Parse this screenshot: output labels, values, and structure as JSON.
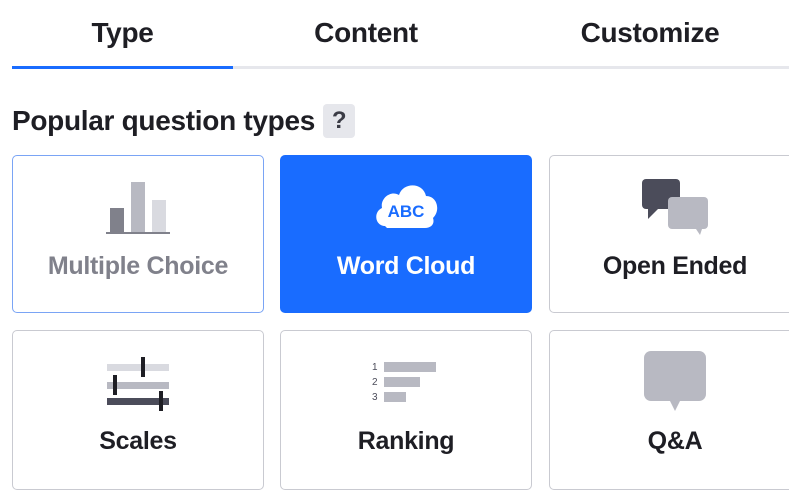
{
  "tabs": [
    {
      "label": "Type",
      "active": true
    },
    {
      "label": "Content",
      "active": false
    },
    {
      "label": "Customize",
      "active": false
    }
  ],
  "section": {
    "title": "Popular question types",
    "help": "?"
  },
  "cards": [
    {
      "label": "Multiple Choice",
      "icon": "bar-chart-icon",
      "state": "hovered"
    },
    {
      "label": "Word Cloud",
      "icon": "abc-cloud-icon",
      "icon_text": "ABC",
      "state": "selected"
    },
    {
      "label": "Open Ended",
      "icon": "speech-bubbles-icon",
      "state": "normal"
    },
    {
      "label": "Scales",
      "icon": "sliders-icon",
      "state": "normal"
    },
    {
      "label": "Ranking",
      "icon": "ranked-list-icon",
      "icon_numbers": [
        "1",
        "2",
        "3"
      ],
      "state": "normal"
    },
    {
      "label": "Q&A",
      "icon": "speech-bubble-icon",
      "state": "normal"
    }
  ],
  "colors": {
    "accent": "#196cff",
    "text": "#1e1e24",
    "muted_text": "#80818b",
    "border": "#c9cad1",
    "icon_gray": "#b8b9c2",
    "icon_dark": "#4b4c5a"
  }
}
